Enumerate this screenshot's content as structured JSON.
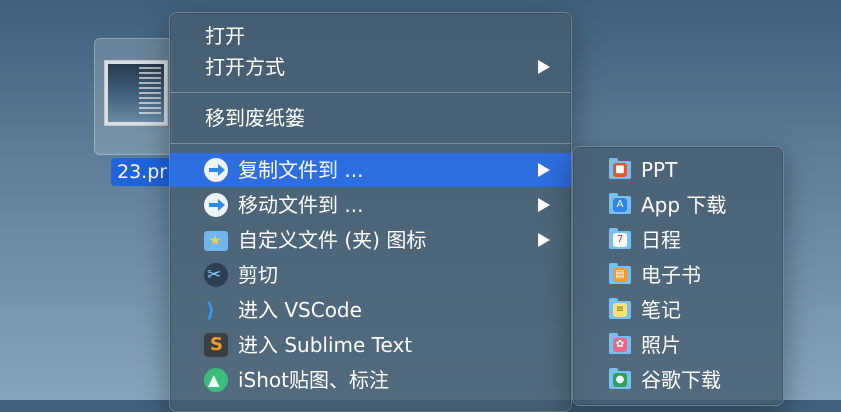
{
  "file": {
    "name": "23.pr"
  },
  "menu": {
    "items": [
      {
        "label": "打开"
      },
      {
        "label": "打开方式"
      },
      {
        "label": "移到废纸篓"
      },
      {
        "label": "复制文件到 ..."
      },
      {
        "label": "移动文件到 ..."
      },
      {
        "label": "自定义文件 (夹) 图标"
      },
      {
        "label": "剪切"
      },
      {
        "label": "进入 VSCode"
      },
      {
        "label": "进入 Sublime Text"
      },
      {
        "label": "iShot贴图、标注"
      }
    ]
  },
  "submenu": {
    "items": [
      {
        "label": "PPT",
        "color": "#e0582f"
      },
      {
        "label": "App 下载",
        "color": "#2f86e8"
      },
      {
        "label": "日程",
        "color": "#ffffff"
      },
      {
        "label": "电子书",
        "color": "#f29b2b"
      },
      {
        "label": "笔记",
        "color": "#f6e27a"
      },
      {
        "label": "照片",
        "color": "#e86a8a"
      },
      {
        "label": "谷歌下载",
        "color": "#2fa35b"
      }
    ]
  },
  "colors": {
    "highlight": "#2d6ee0",
    "selection": "#1f63dd"
  }
}
